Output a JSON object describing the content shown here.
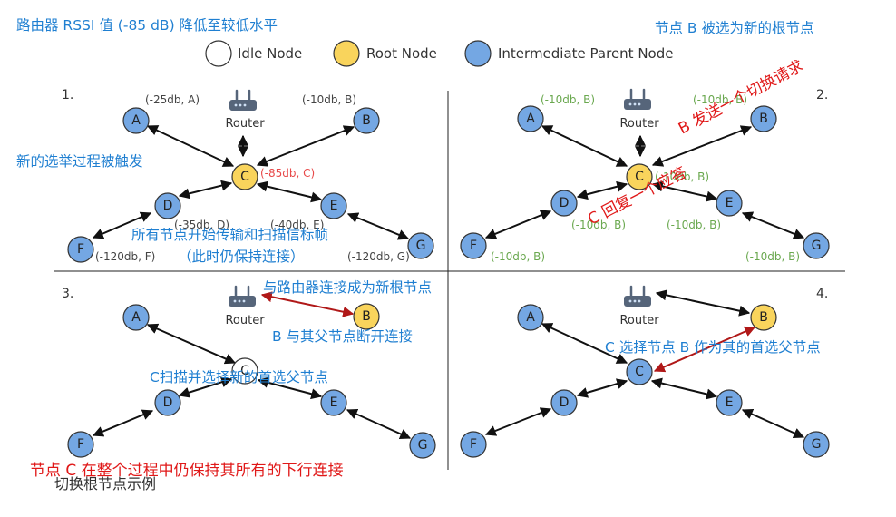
{
  "colors": {
    "idle": "#ffffff",
    "root": "#f9d45c",
    "intermediate": "#74a7e3",
    "blue_text": "#1f7fd1",
    "red_text": "#e01818",
    "green_text": "#6aa84f",
    "link": "#111111",
    "new_link": "#b01818"
  },
  "icons": {
    "router": "router-icon"
  },
  "legend": {
    "idle": "Idle Node",
    "root": "Root Node",
    "intermediate": "Intermediate Parent Node"
  },
  "router_label": "Router",
  "caption": "切换根节点示例",
  "panels": [
    {
      "num": "1.",
      "nodes": {
        "A": "A",
        "B": "B",
        "C": "C",
        "D": "D",
        "E": "E",
        "F": "F",
        "G": "G"
      },
      "rssi": {
        "A": "(-25db, A)",
        "B": "(-10db, B)",
        "C": "(-85db, C)",
        "D": "(-35db, D)",
        "E": "(-40db, E)",
        "F": "(-120db, F)",
        "G": "(-120db, G)"
      },
      "notes": {
        "title": "路由器 RSSI 值 (-85 dB) 降低至较低水平",
        "election": "新的选举过程被触发",
        "beacon_1": "所有节点开始传输和扫描信标帧",
        "beacon_2": "（此时仍保持连接）"
      }
    },
    {
      "num": "2.",
      "nodes": {
        "A": "A",
        "B": "B",
        "C": "C",
        "D": "D",
        "E": "E",
        "F": "F",
        "G": "G"
      },
      "rssi": {
        "A": "(-10db, B)",
        "B": "(-10db, B)",
        "C": "(-10db, B)",
        "D": "(-10db, B)",
        "E": "(-10db, B)",
        "F": "(-10db, B)",
        "G": "(-10db, B)"
      },
      "notes": {
        "title": "节点 B 被选为新的根节点",
        "request": "B 发送一个切换请求",
        "reply": "C 回复一个应答"
      }
    },
    {
      "num": "3.",
      "nodes": {
        "A": "A",
        "B": "B",
        "C": "C",
        "D": "D",
        "E": "E",
        "F": "F",
        "G": "G"
      },
      "notes": {
        "connect": "与路由器连接成为新根节点",
        "disconnect": "B 与其父节点断开连接",
        "scan": "C扫描并选择新的首选父节点",
        "keep": "节点 C 在整个过程中仍保持其所有的下行连接"
      }
    },
    {
      "num": "4.",
      "nodes": {
        "A": "A",
        "B": "B",
        "C": "C",
        "D": "D",
        "E": "E",
        "F": "F",
        "G": "G"
      },
      "notes": {
        "choose": "C 选择节点 B 作为其的首选父节点"
      }
    }
  ]
}
